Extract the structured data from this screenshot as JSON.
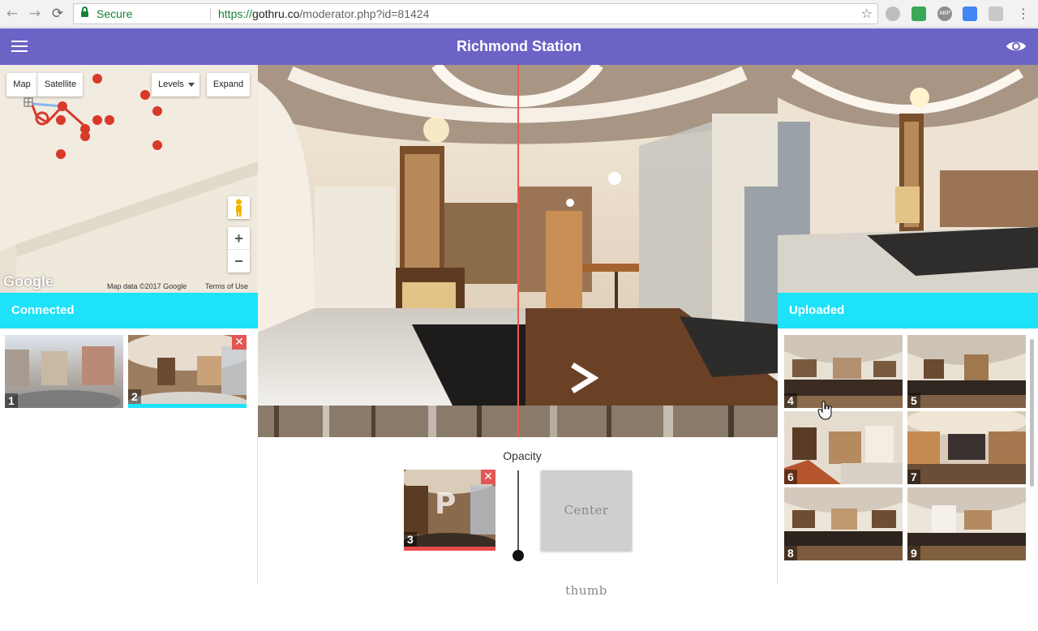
{
  "browser": {
    "secure_label": "Secure",
    "url_scheme": "https://",
    "url_host": "gothru.co",
    "url_path": "/moderator.php?id=81424",
    "back_icon": "←",
    "forward_icon": "→",
    "reload_icon": "⟳",
    "star_icon": "☆",
    "menu_icon": "⋮"
  },
  "app": {
    "title": "Richmond Station"
  },
  "map": {
    "type_buttons": [
      "Map",
      "Satellite"
    ],
    "levels_label": "Levels",
    "expand_label": "Expand",
    "zoom_in": "+",
    "zoom_out": "−",
    "google_logo": "Google",
    "map_data": "Map data ©2017 Google",
    "terms": "Terms of Use"
  },
  "connected": {
    "heading": "Connected",
    "thumbs": [
      {
        "number": "1"
      },
      {
        "number": "2"
      }
    ]
  },
  "uploaded": {
    "heading": "Uploaded",
    "thumbs": [
      {
        "number": "4"
      },
      {
        "number": "5"
      },
      {
        "number": "6"
      },
      {
        "number": "7"
      },
      {
        "number": "8"
      },
      {
        "number": "9"
      }
    ]
  },
  "editor": {
    "opacity_label": "Opacity",
    "center_thumb_label": "Center thumb",
    "current_thumb_number": "3",
    "current_thumb_badge": "P",
    "close_glyph": "✕",
    "opacity_value": 0
  },
  "colors": {
    "appbar": "#6c63c7",
    "section_header": "#1de2f8",
    "map_marker": "#d8392b",
    "close_button": "#e25656"
  }
}
